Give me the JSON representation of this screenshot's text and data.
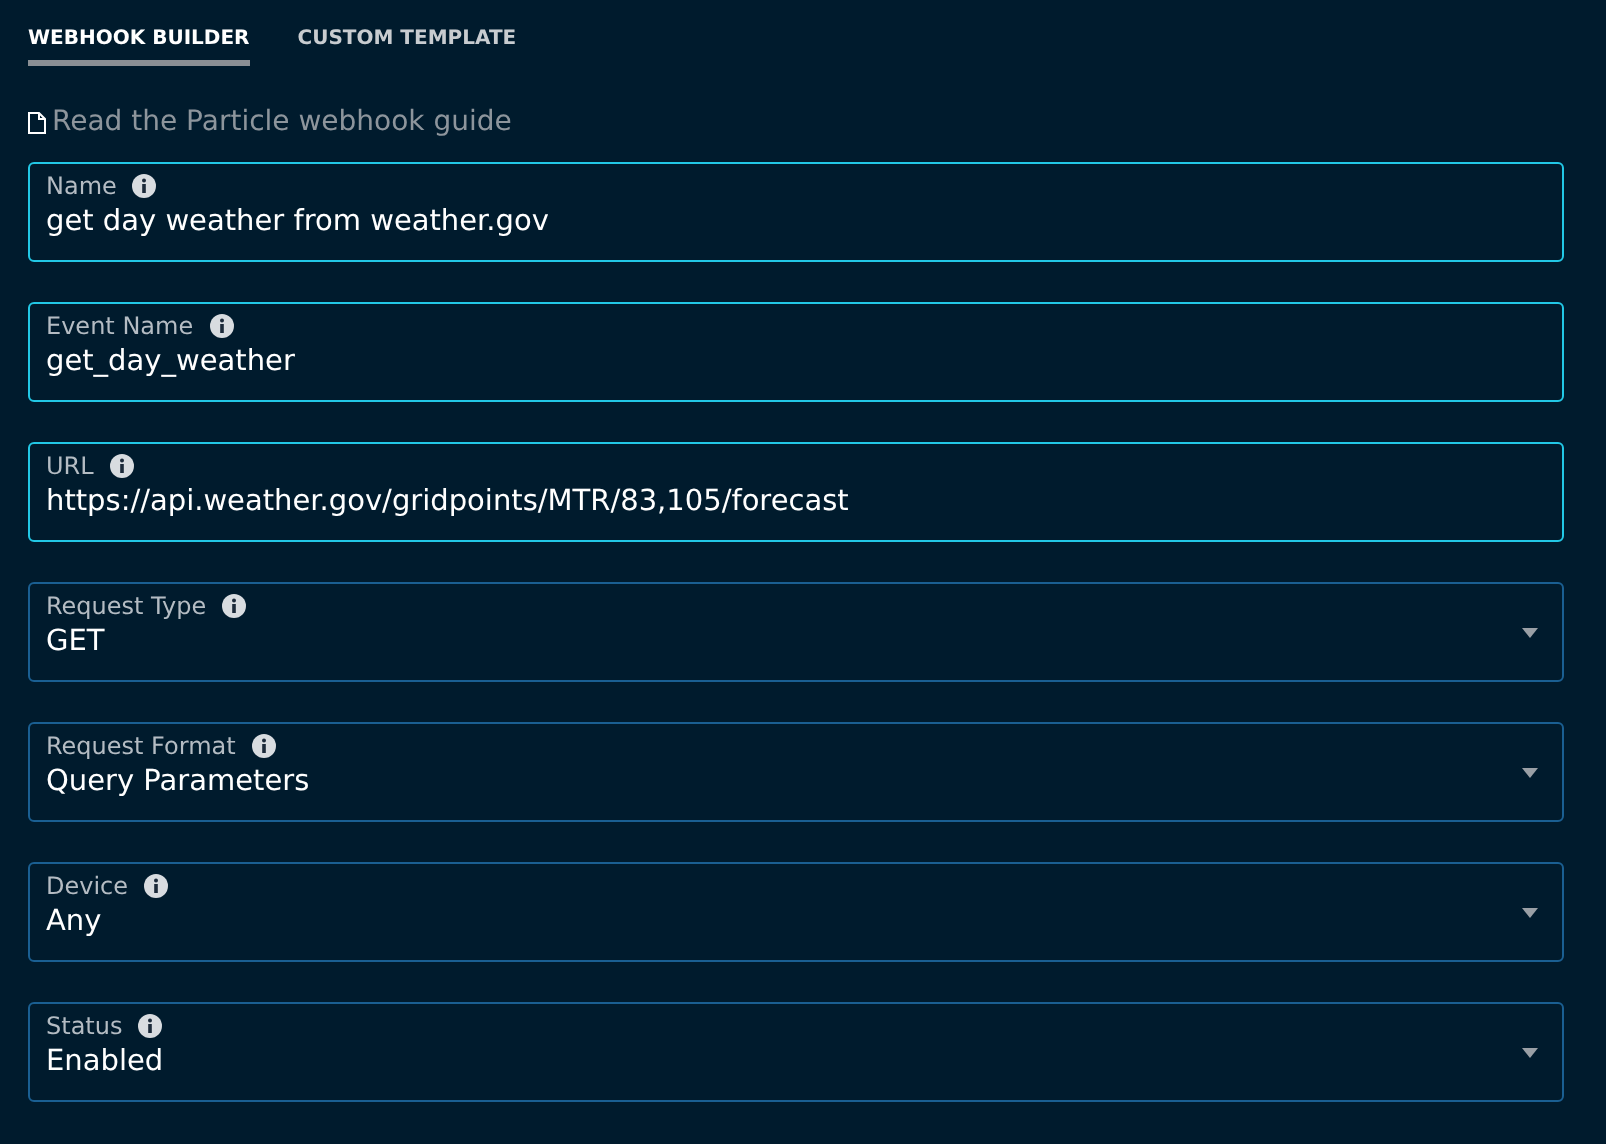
{
  "tabs": [
    {
      "label": "WEBHOOK BUILDER",
      "selected": true
    },
    {
      "label": "CUSTOM TEMPLATE",
      "selected": false
    }
  ],
  "guide_link": "Read the Particle webhook guide",
  "fields": [
    {
      "kind": "text",
      "label": "Name",
      "value": "get day weather from weather.gov"
    },
    {
      "kind": "text",
      "label": "Event Name",
      "value": "get_day_weather"
    },
    {
      "kind": "text",
      "label": "URL",
      "value": "https://api.weather.gov/gridpoints/MTR/83,105/forecast"
    },
    {
      "kind": "select",
      "label": "Request Type",
      "value": "GET"
    },
    {
      "kind": "select",
      "label": "Request Format",
      "value": "Query Parameters"
    },
    {
      "kind": "select",
      "label": "Device",
      "value": "Any"
    },
    {
      "kind": "select",
      "label": "Status",
      "value": "Enabled"
    }
  ]
}
